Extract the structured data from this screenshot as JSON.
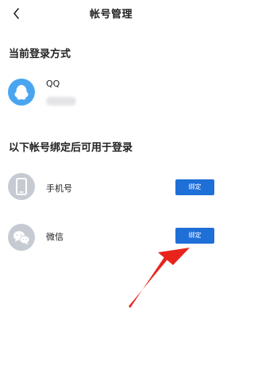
{
  "header": {
    "title": "帐号管理",
    "back_icon": "chevron-left-icon"
  },
  "current_login": {
    "heading": "当前登录方式",
    "account": {
      "name": "QQ",
      "icon": "qq-penguin-icon",
      "icon_bg": "#4aa5f0"
    }
  },
  "bind_section": {
    "heading": "以下帐号绑定后可用于登录",
    "items": [
      {
        "label": "手机号",
        "icon": "phone-icon",
        "button_label": "绑定"
      },
      {
        "label": "微信",
        "icon": "wechat-icon",
        "button_label": "绑定"
      }
    ]
  },
  "colors": {
    "accent": "#1e6fd8",
    "icon_gray": "#c6cad2",
    "annotation_arrow": "#e8231c"
  }
}
